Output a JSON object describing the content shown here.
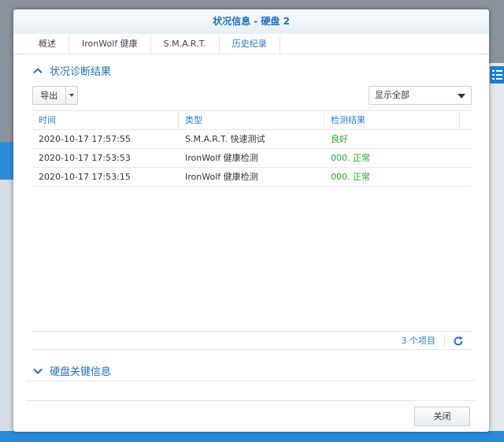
{
  "dialog": {
    "title": "状况信息 - 硬盘 2",
    "tabs": [
      {
        "label": "概述"
      },
      {
        "label": "IronWolf 健康"
      },
      {
        "label": "S.M.A.R.T."
      },
      {
        "label": "历史纪录",
        "active": true
      }
    ]
  },
  "status_section": {
    "title": "状况诊断结果",
    "expanded": true
  },
  "toolbar": {
    "export_label": "导出",
    "filter_value": "显示全部"
  },
  "grid": {
    "columns": [
      "时间",
      "类型",
      "检测结果"
    ],
    "rows": [
      {
        "time": "2020-10-17 17:57:55",
        "type": "S.M.A.R.T. 快速测试",
        "result": "良好"
      },
      {
        "time": "2020-10-17 17:53:53",
        "type": "IronWolf 健康检测",
        "result": "000. 正常"
      },
      {
        "time": "2020-10-17 17:53:15",
        "type": "IronWolf 健康检测",
        "result": "000. 正常"
      }
    ],
    "footer_count": "3 个项目"
  },
  "key_info_section": {
    "title": "硬盘关键信息",
    "expanded": false
  },
  "footer": {
    "close_label": "关闭"
  },
  "colors": {
    "accent": "#1f6fb8",
    "ok": "#2aa52e",
    "desktop_blue": "#2a8ad6"
  }
}
